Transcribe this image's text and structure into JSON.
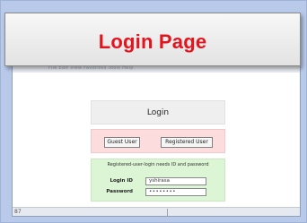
{
  "slide": {
    "title": "Login Page"
  },
  "browser": {
    "menu_text": "File   Edit   View   Favorites   Tools   Help",
    "status_text": "87"
  },
  "login": {
    "header": "Login",
    "guest_button": "Guest User",
    "registered_button": "Registered User",
    "note": "Registered-user-login needs ID and password",
    "id_label": "Login ID",
    "id_value": "yshirasa",
    "password_label": "Password",
    "password_value": "••••••••"
  },
  "colors": {
    "title": "#e4141e",
    "slide_bg": "#b8c9ea",
    "panel_red": "#fcdcdc",
    "panel_green": "#dcf5d4"
  }
}
